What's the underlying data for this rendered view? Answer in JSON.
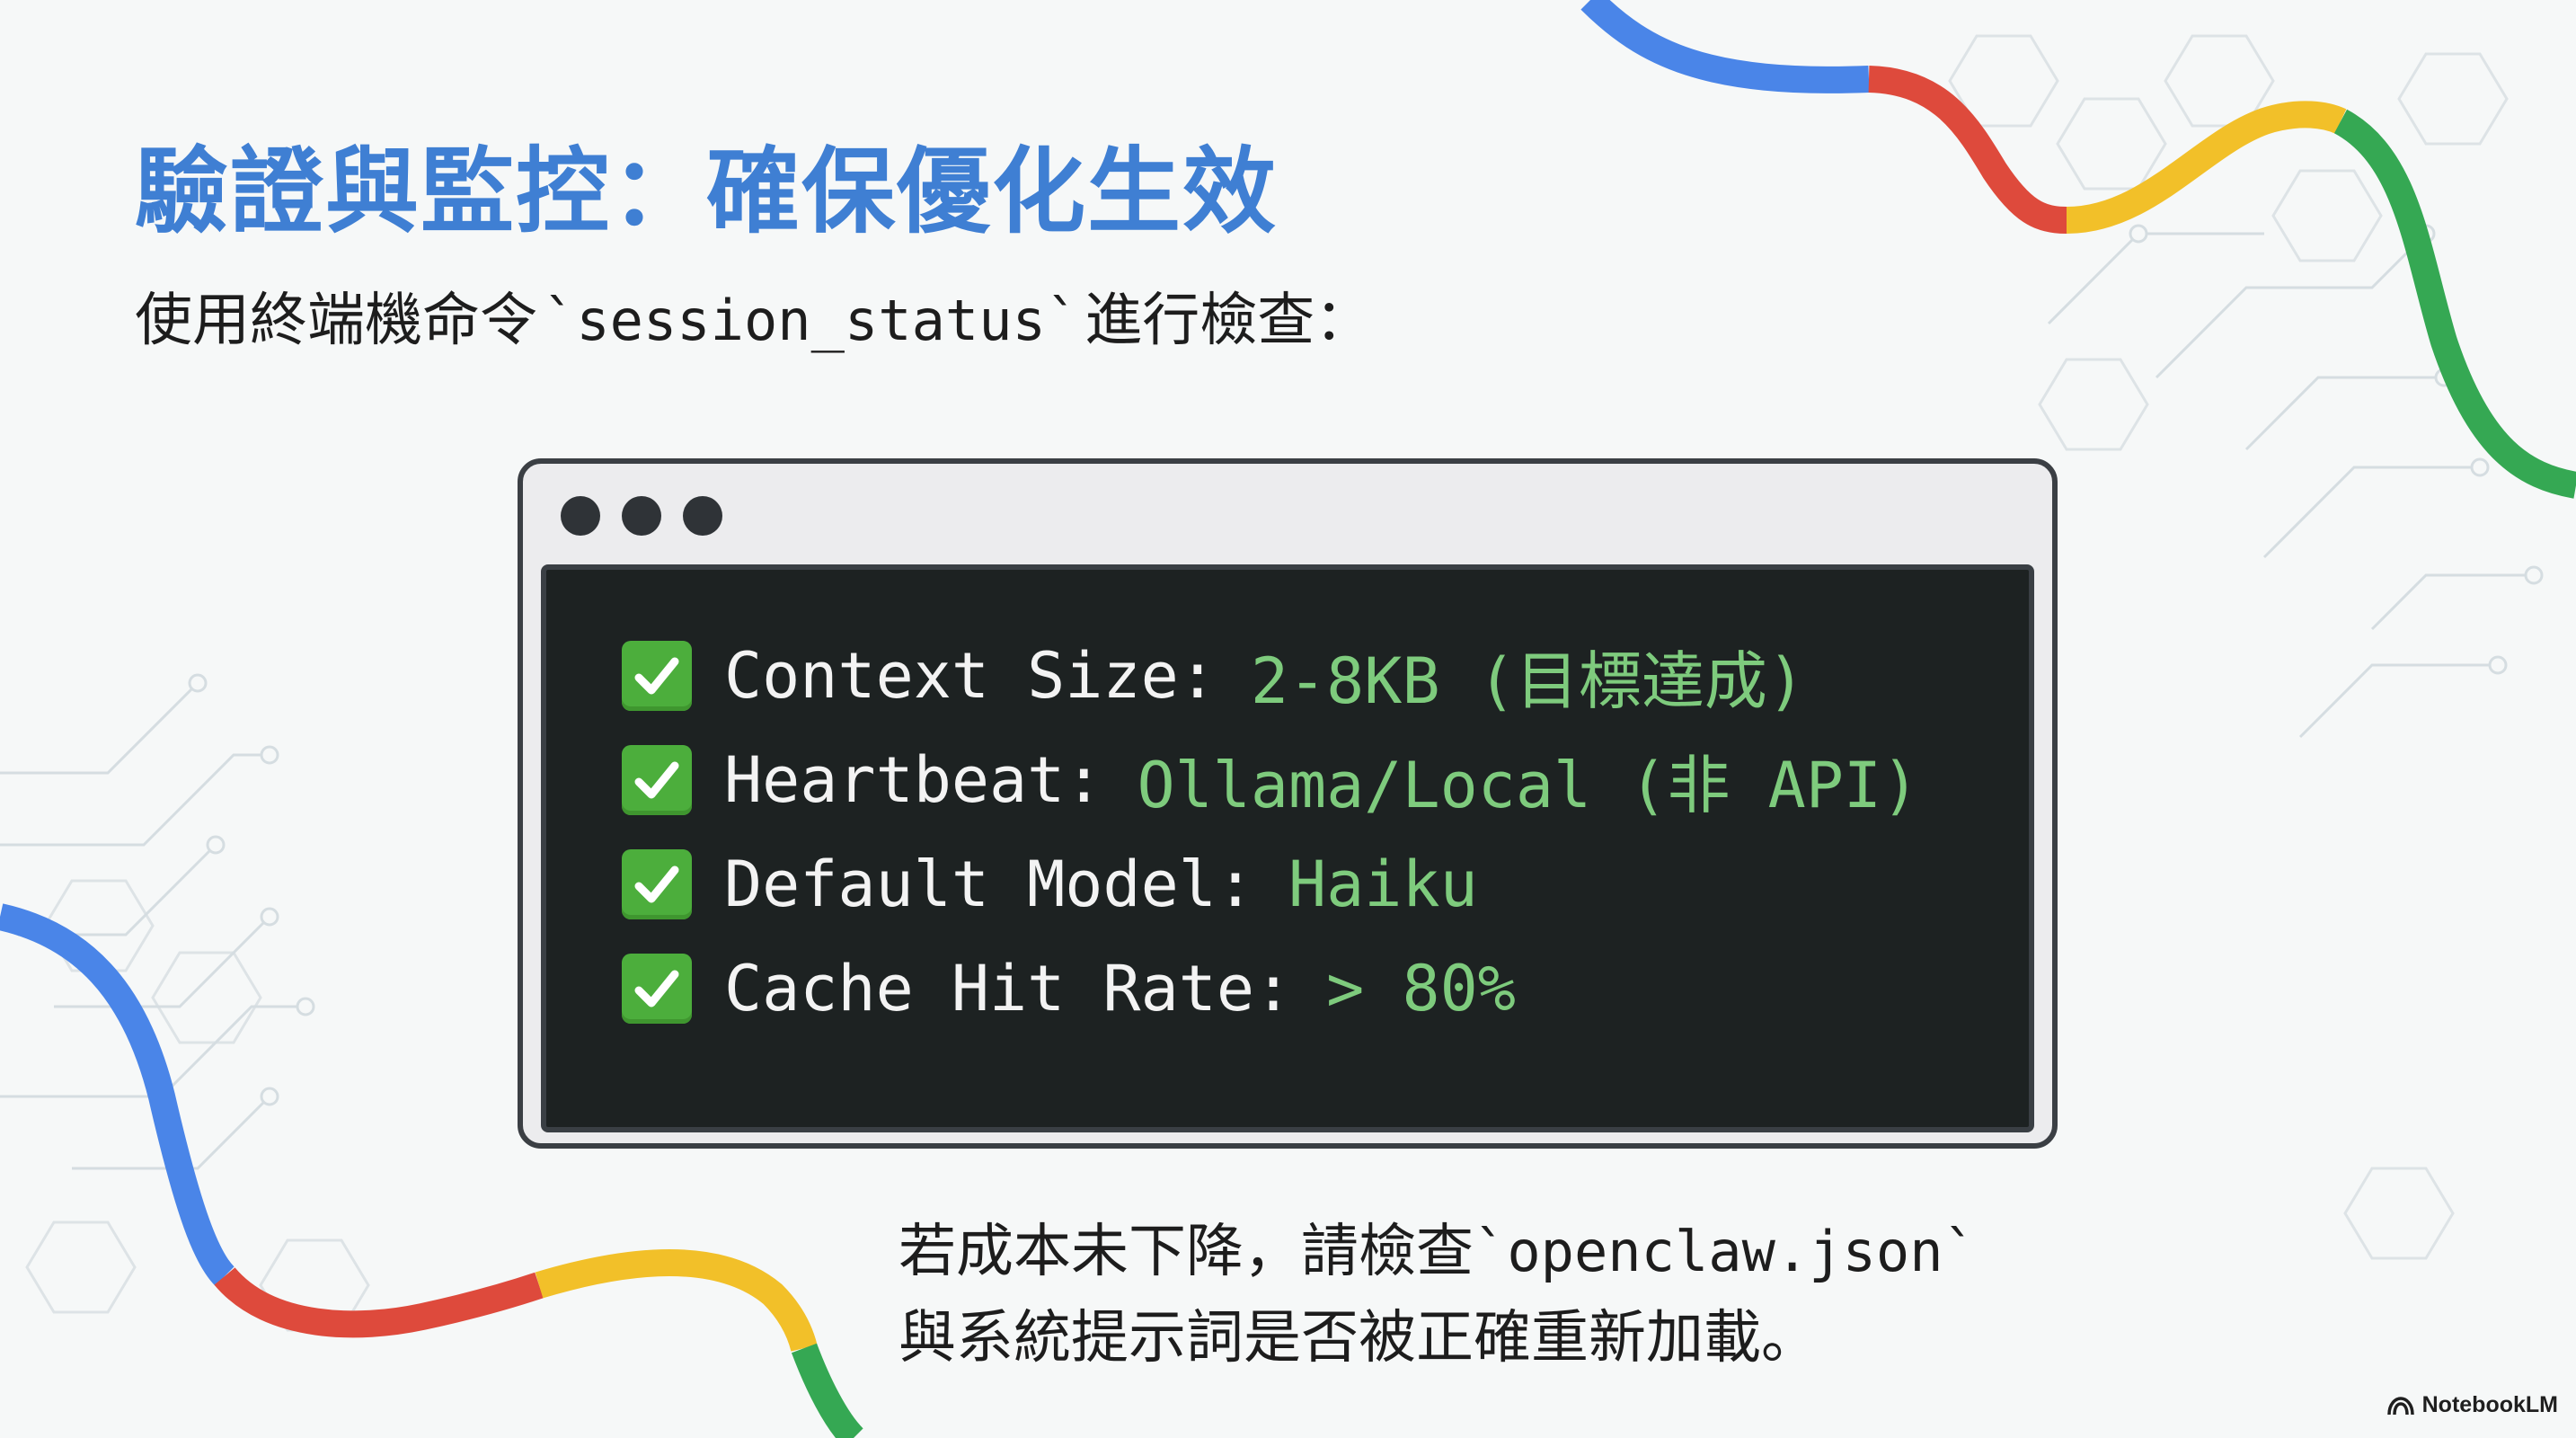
{
  "slide": {
    "title": "驗證與監控：確保優化生效",
    "subtitle_prefix": "使用終端機命令",
    "subtitle_command": "`session_status`",
    "subtitle_suffix": "進行檢查："
  },
  "terminal": {
    "checks": [
      {
        "icon": "green-checkmark-icon",
        "key": "Context Size:",
        "value": "2-8KB (目標達成)"
      },
      {
        "icon": "green-checkmark-icon",
        "key": "Heartbeat:",
        "value": "Ollama/Local (非 API)"
      },
      {
        "icon": "green-checkmark-icon",
        "key": "Default Model:",
        "value": "Haiku"
      },
      {
        "icon": "green-checkmark-icon",
        "key": "Cache Hit Rate:",
        "value": "> 80%"
      }
    ]
  },
  "footer": {
    "line1_prefix": "若成本未下降，請檢查",
    "line1_file": "`openclaw.json`",
    "line2": "與系統提示詞是否被正確重新加載。"
  },
  "brand": {
    "name": "NotebookLM",
    "icon": "notebooklm-logo-icon"
  },
  "colors": {
    "title": "#3f7fd3",
    "terminal_bg": "#1d2222",
    "value_green": "#7ecb7d",
    "ribbon": [
      "#4a85e8",
      "#de4a3c",
      "#f2c029",
      "#35a853"
    ]
  }
}
